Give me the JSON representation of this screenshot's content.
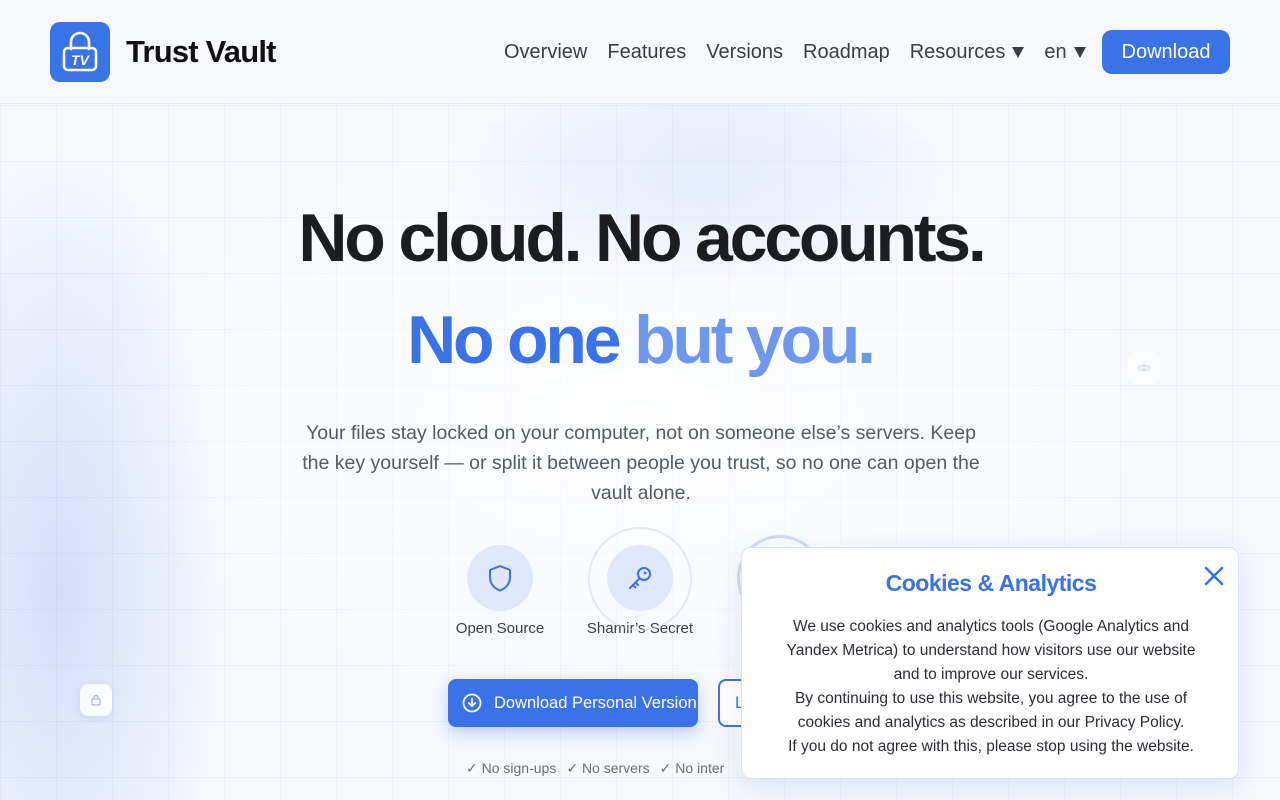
{
  "header": {
    "logo_text": "TV",
    "brand": "Trust Vault",
    "nav": {
      "overview": "Overview",
      "features": "Features",
      "versions": "Versions",
      "roadmap": "Roadmap",
      "resources": "Resources",
      "language": "en"
    },
    "download_label": "Download"
  },
  "hero": {
    "line1": "No cloud. No accounts.",
    "line2_a": "No one",
    "line2_b": "but you.",
    "subtitle": "Your files stay locked on your computer, not on someone else’s servers. Keep the key yourself — or split it between people you trust, so no one can open the vault alone."
  },
  "features": [
    {
      "label": "Open Source",
      "icon": "shield-icon"
    },
    {
      "label": "Shamir’s Secret",
      "icon": "key-icon"
    }
  ],
  "cta": {
    "primary_label": "Download Personal Version",
    "secondary_label": "L"
  },
  "checks": [
    "✓ No sign-ups",
    "✓ No servers",
    "✓ No inter"
  ],
  "cookie": {
    "title": "Cookies & Analytics",
    "line1": "We use cookies and analytics tools (Google Analytics and Yandex Metrica) to understand how visitors use our website and to improve our services.",
    "line2": "By continuing to use this website, you agree to the use of cookies and analytics as described in our Privacy Policy.",
    "line3": "If you do not agree with this, please stop using the website."
  },
  "colors": {
    "accent": "#3a72e8",
    "accent_light": "#6d98ee",
    "heading": "#1c1d21"
  }
}
